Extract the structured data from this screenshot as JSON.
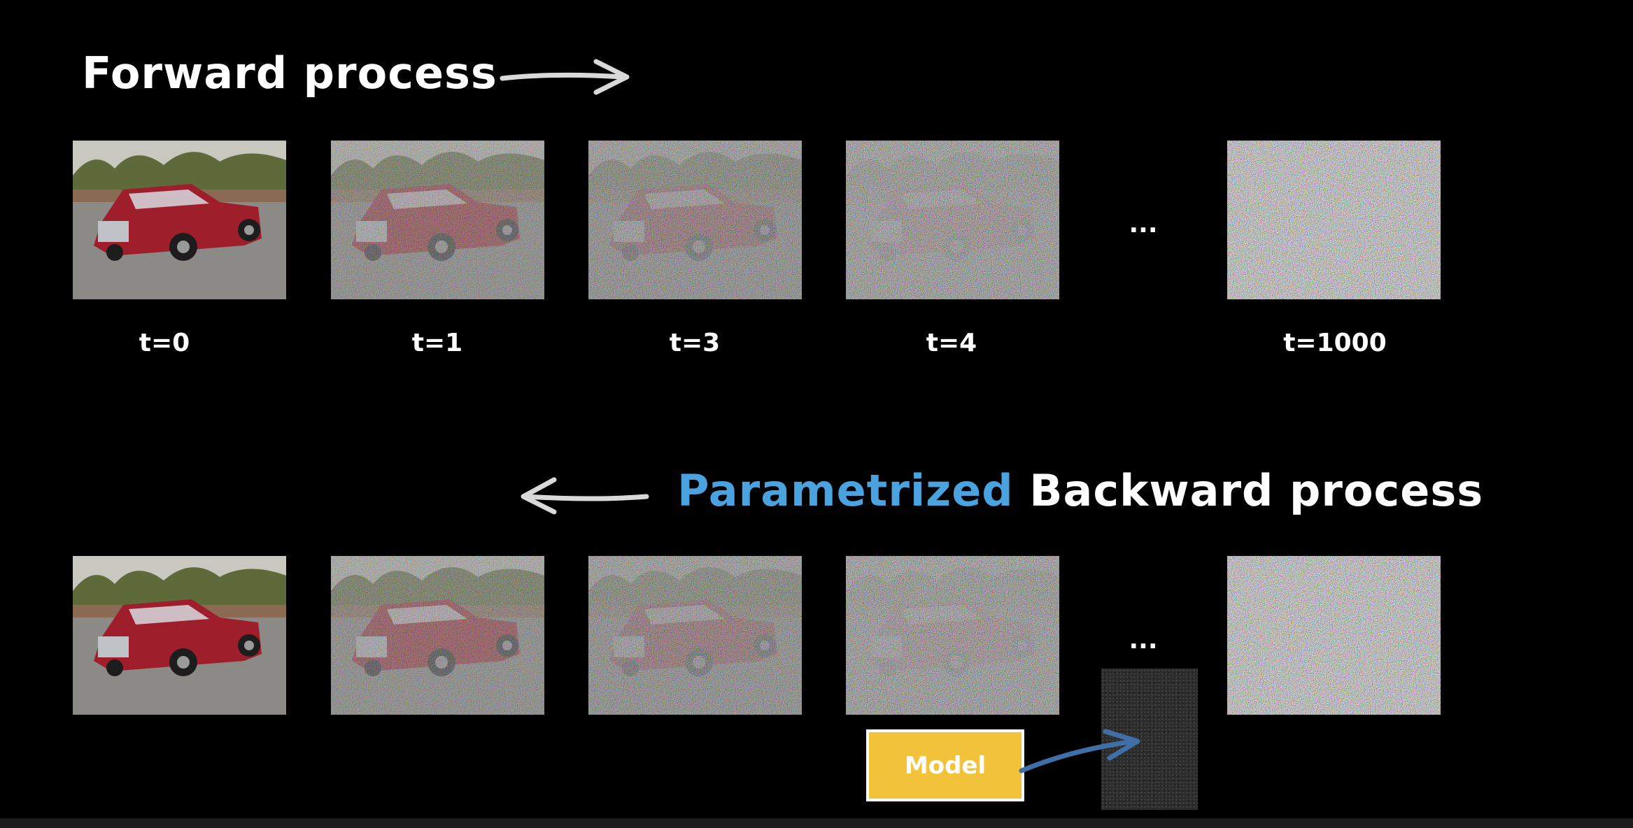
{
  "forward": {
    "title": "Forward process",
    "labels": [
      "t=0",
      "t=1",
      "t=3",
      "t=4",
      "t=1000"
    ],
    "ellipsis": "..."
  },
  "backward": {
    "title_accent": "Parametrized",
    "title_rest": "Backward process",
    "ellipsis": "..."
  },
  "model": {
    "label": "Model"
  },
  "colors": {
    "background": "#000000",
    "accent": "#4aa3df",
    "model_box": "#f2c33a",
    "model_arrow": "#3f6fa6",
    "truck": "#9e1f2b"
  },
  "noise_levels": [
    0,
    0.25,
    0.5,
    0.7,
    1.0
  ]
}
